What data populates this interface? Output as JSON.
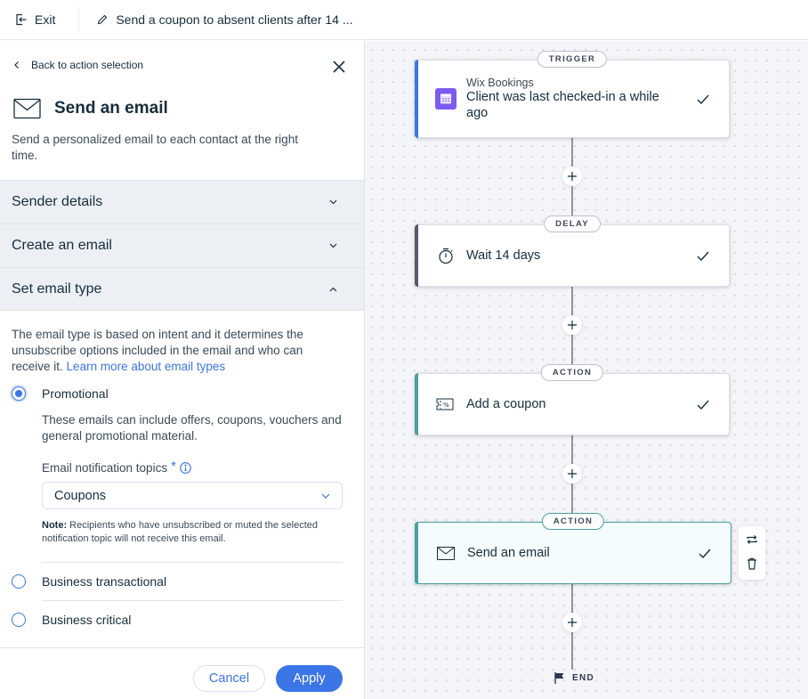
{
  "topbar": {
    "exit_label": "Exit",
    "flow_title": "Send a coupon to absent clients after 14 ..."
  },
  "panel": {
    "back_label": "Back to action selection",
    "title": "Send an email",
    "description": "Send a personalized email to each contact at the right time.",
    "accordions": [
      {
        "label": "Sender details",
        "state": "collapsed"
      },
      {
        "label": "Create an email",
        "state": "collapsed"
      },
      {
        "label": "Set email type",
        "state": "expanded"
      }
    ],
    "email_type": {
      "description": "The email type is based on intent and it determines the unsubscribe options included in the email and who can receive it.",
      "learn_more": "Learn more about email types",
      "options": [
        {
          "label": "Promotional",
          "selected": true
        },
        {
          "label": "Business transactional",
          "selected": false
        },
        {
          "label": "Business critical",
          "selected": false
        }
      ],
      "promotional_description": "These emails can include offers, coupons, vouchers and general promotional material.",
      "topics_label": "Email notification topics",
      "required_mark": "*",
      "topics_value": "Coupons",
      "note_prefix": "Note:",
      "note_text": " Recipients who have unsubscribed or muted the selected notification topic will not receive this email."
    },
    "buttons": {
      "cancel": "Cancel",
      "apply": "Apply"
    }
  },
  "canvas": {
    "nodes": [
      {
        "badge": "TRIGGER",
        "subtitle": "Wix Bookings",
        "title": "Client was last checked-in a while ago",
        "icon": "calendar-icon",
        "accent": "#3b75e6",
        "status": "done"
      },
      {
        "badge": "DELAY",
        "title": "Wait 14 days",
        "icon": "stopwatch-icon",
        "accent": "#545a6b",
        "status": "done"
      },
      {
        "badge": "ACTION",
        "title": "Add a coupon",
        "icon": "coupon-icon",
        "accent": "#4a9fa0",
        "status": "done"
      },
      {
        "badge": "ACTION",
        "title": "Send an email",
        "icon": "envelope-icon",
        "accent": "#4a9fa0",
        "status": "done",
        "selected": true
      }
    ],
    "end_label": "END"
  },
  "colors": {
    "primary": "#3b75e6",
    "trigger_accent": "#3b75e6",
    "delay_accent": "#545a6b",
    "action_accent": "#4a9fa0",
    "calendar_icon_bg": "#7c5cf0"
  }
}
